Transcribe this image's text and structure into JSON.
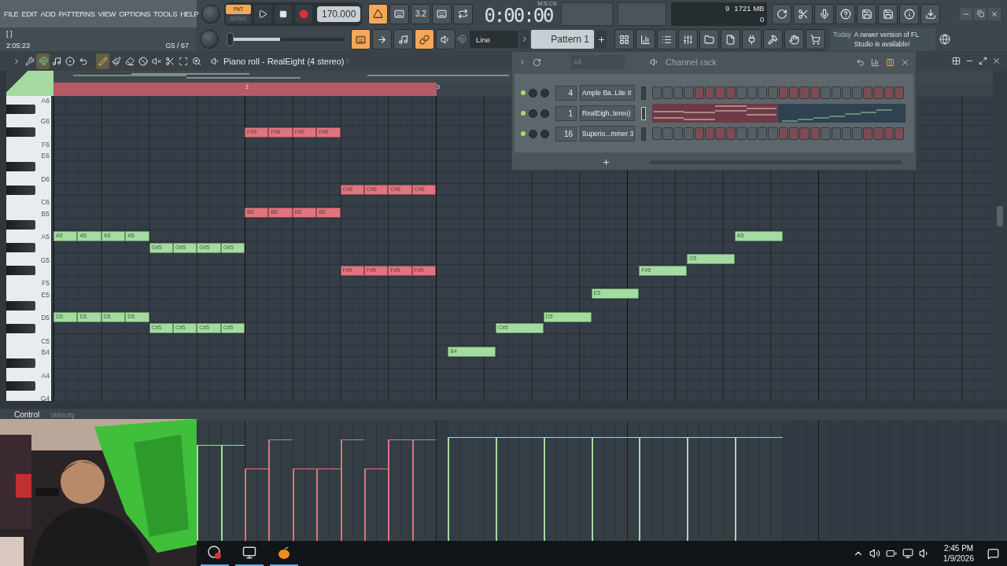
{
  "menu": [
    "FILE",
    "EDIT",
    "ADD",
    "PATTERNS",
    "VIEW",
    "OPTIONS",
    "TOOLS",
    "HELP"
  ],
  "transport": {
    "modes": [
      {
        "label": "PAT",
        "selected": true
      },
      {
        "label": "SONG",
        "selected": false
      }
    ],
    "tempo": "170.000"
  },
  "record_buttons": [
    {
      "on": true
    },
    {
      "on": false
    },
    {
      "on": false,
      "label": "3.2"
    },
    {
      "on": false
    },
    {
      "on": false
    }
  ],
  "time": {
    "value": "0:00:00",
    "unit": "M:S:CS"
  },
  "monitor": {
    "polyphony": "9",
    "memory": "1721 MB",
    "cpu": "0"
  },
  "hint": {
    "bracket": "[  ]",
    "time": "2:05:23",
    "note": "G5 / 67"
  },
  "pitch": {
    "level": 0.45
  },
  "tool_buttons": [
    {
      "on": true
    },
    {
      "on": false
    },
    {
      "on": false
    },
    {
      "on": true
    },
    {
      "on": false
    }
  ],
  "snap": {
    "value": "Line"
  },
  "pattern": {
    "value": "Pattern 1"
  },
  "news": {
    "date": "Today",
    "message": "A newer version of FL Studio is available!"
  },
  "piano_roll": {
    "title": "Piano roll - RealEight (4 stereo)",
    "snap_on": true,
    "tools": [
      {
        "selected": true
      },
      {
        "selected": false
      },
      {
        "selected": false
      },
      {
        "selected": false
      },
      {
        "selected": false
      },
      {
        "selected": false
      },
      {
        "selected": false
      },
      {
        "selected": false
      }
    ],
    "markers": [
      "2",
      "3"
    ],
    "rows": [
      {
        "kind": "white",
        "label": "A6"
      },
      {
        "kind": "black"
      },
      {
        "kind": "white",
        "label": "G6"
      },
      {
        "kind": "black",
        "notes": [
          {
            "kind": "rest_bar"
          },
          {
            "kind": "eighth",
            "label": "F#6",
            "color": "#e0747f",
            "level": 0.6
          },
          {
            "kind": "eighth",
            "label": "F#6",
            "color": "#e0747f",
            "level": 0.84
          },
          {
            "kind": "eighth",
            "label": "F#6",
            "color": "#e0747f",
            "level": 0.6
          },
          {
            "kind": "eighth",
            "label": "F#6",
            "color": "#e0747f",
            "level": 0.6
          }
        ]
      },
      {
        "kind": "white",
        "label": "F6"
      },
      {
        "kind": "white",
        "label": "E6"
      },
      {
        "kind": "black"
      },
      {
        "kind": "white",
        "label": "D6"
      },
      {
        "kind": "black",
        "notes": [
          {
            "kind": "rest_bar"
          },
          {
            "kind": "rest_beat"
          },
          {
            "kind": "rest_beat"
          },
          {
            "kind": "eighth",
            "label": "C#6",
            "color": "#e0747f",
            "level": 0.84
          },
          {
            "kind": "eighth",
            "label": "C#6",
            "color": "#e0747f",
            "level": 0.6
          },
          {
            "kind": "eighth",
            "label": "C#6",
            "color": "#e0747f",
            "level": 0.84
          },
          {
            "kind": "eighth",
            "label": "C#6",
            "color": "#e0747f",
            "level": 0.84
          }
        ]
      },
      {
        "kind": "white",
        "label": "C6"
      },
      {
        "kind": "white",
        "label": "B5",
        "notes": [
          {
            "kind": "rest_bar"
          },
          {
            "kind": "eighth",
            "label": "B5",
            "color": "#e0747f"
          },
          {
            "kind": "eighth",
            "label": "B5",
            "color": "#e0747f"
          },
          {
            "kind": "eighth",
            "label": "B5",
            "color": "#e0747f"
          },
          {
            "kind": "eighth",
            "label": "B5",
            "color": "#e0747f"
          }
        ]
      },
      {
        "kind": "black"
      },
      {
        "kind": "white",
        "label": "A5",
        "notes": [
          {
            "kind": "eighth",
            "label": "A5",
            "color": "#a3dca0"
          },
          {
            "kind": "eighth",
            "label": "A5",
            "color": "#a3dca0"
          },
          {
            "kind": "eighth",
            "label": "A5",
            "color": "#a3dca0"
          },
          {
            "kind": "eighth",
            "label": "A5",
            "color": "#a3dca0"
          },
          {
            "kind": "rest_bar"
          },
          {
            "kind": "rest_bar"
          },
          {
            "kind": "rest_bar"
          },
          {
            "kind": "rest_step"
          },
          {
            "kind": "quarter",
            "label": "A5",
            "color": "#a3dca0",
            "level": 0.86
          }
        ]
      },
      {
        "kind": "black",
        "notes": [
          {
            "kind": "rest_beat"
          },
          {
            "kind": "rest_beat"
          },
          {
            "kind": "eighth",
            "label": "G#5",
            "color": "#a3dca0"
          },
          {
            "kind": "eighth",
            "label": "G#5",
            "color": "#a3dca0"
          },
          {
            "kind": "eighth",
            "label": "G#5",
            "color": "#a3dca0",
            "level": 0.8
          },
          {
            "kind": "eighth",
            "label": "G#5",
            "color": "#a3dca0",
            "level": 0.8
          }
        ]
      },
      {
        "kind": "white",
        "label": "G5",
        "notes": [
          {
            "kind": "rest_bar"
          },
          {
            "kind": "rest_bar"
          },
          {
            "kind": "rest_bar"
          },
          {
            "kind": "rest_beat"
          },
          {
            "kind": "rest_step"
          },
          {
            "kind": "quarter",
            "label": "G5",
            "color": "#a3dca0",
            "level": 0.86
          }
        ]
      },
      {
        "kind": "black",
        "notes": [
          {
            "kind": "rest_bar"
          },
          {
            "kind": "rest_beat"
          },
          {
            "kind": "rest_beat"
          },
          {
            "kind": "eighth",
            "label": "F#5",
            "color": "#e0747f"
          },
          {
            "kind": "eighth",
            "label": "F#5",
            "color": "#e0747f"
          },
          {
            "kind": "eighth",
            "label": "F#5",
            "color": "#e0747f"
          },
          {
            "kind": "eighth",
            "label": "F#5",
            "color": "#e0747f"
          },
          {
            "kind": "rest_bar"
          },
          {
            "kind": "rest_step"
          },
          {
            "kind": "quarter",
            "label": "F#5",
            "color": "#a3dca0",
            "level": 0.86
          }
        ]
      },
      {
        "kind": "white",
        "label": "F5"
      },
      {
        "kind": "white",
        "label": "E5",
        "notes": [
          {
            "kind": "rest_bar"
          },
          {
            "kind": "rest_bar"
          },
          {
            "kind": "rest_beat"
          },
          {
            "kind": "rest_beat"
          },
          {
            "kind": "rest_beat"
          },
          {
            "kind": "rest_step"
          },
          {
            "kind": "quarter",
            "label": "E5",
            "color": "#a3dca0",
            "level": 0.86
          }
        ]
      },
      {
        "kind": "black"
      },
      {
        "kind": "white",
        "label": "D5",
        "notes": [
          {
            "kind": "eighth",
            "label": "D5",
            "color": "#a3dca0"
          },
          {
            "kind": "eighth",
            "label": "D5",
            "color": "#a3dca0"
          },
          {
            "kind": "eighth",
            "label": "D5",
            "color": "#a3dca0"
          },
          {
            "kind": "eighth",
            "label": "D5",
            "color": "#a3dca0"
          },
          {
            "kind": "rest_bar"
          },
          {
            "kind": "rest_bar"
          },
          {
            "kind": "rest_step"
          },
          {
            "kind": "quarter",
            "label": "D5",
            "color": "#a3dca0",
            "level": 0.86
          }
        ]
      },
      {
        "kind": "black",
        "notes": [
          {
            "kind": "rest_beat"
          },
          {
            "kind": "rest_beat"
          },
          {
            "kind": "eighth",
            "label": "C#5",
            "color": "#a3dca0"
          },
          {
            "kind": "eighth",
            "label": "C#5",
            "color": "#a3dca0"
          },
          {
            "kind": "eighth",
            "label": "C#5",
            "color": "#a3dca0"
          },
          {
            "kind": "eighth",
            "label": "C#5",
            "color": "#a3dca0"
          },
          {
            "kind": "rest_bar"
          },
          {
            "kind": "rest_beat"
          },
          {
            "kind": "rest_step"
          },
          {
            "kind": "quarter",
            "label": "C#5",
            "color": "#a3dca0",
            "level": 0.86
          }
        ]
      },
      {
        "kind": "white",
        "label": "C5"
      },
      {
        "kind": "white",
        "label": "B4",
        "notes": [
          {
            "kind": "rest_bar"
          },
          {
            "kind": "rest_bar"
          },
          {
            "kind": "rest_step"
          },
          {
            "kind": "quarter",
            "label": "B4",
            "color": "#a3dca0",
            "level": 0.86
          }
        ]
      },
      {
        "kind": "black"
      },
      {
        "kind": "white",
        "label": "A4"
      },
      {
        "kind": "black"
      },
      {
        "kind": "white",
        "label": "G4"
      }
    ]
  },
  "channel_rack": {
    "filter": "All",
    "title": "Channel rack",
    "channels": [
      {
        "kind": "steps",
        "on": true,
        "mixer": "4",
        "name": "Ample Ba..Lite II"
      },
      {
        "kind": "preview",
        "on": true,
        "mixer": "1",
        "name": "RealEigh..tereo)"
      },
      {
        "kind": "steps",
        "on": true,
        "mixer": "16",
        "name": "Superio...mmer 3"
      }
    ]
  },
  "control": {
    "label": "Control",
    "target": "Velocity"
  },
  "taskbar": {
    "time": "2:45 PM",
    "date": "1/9/2026"
  }
}
